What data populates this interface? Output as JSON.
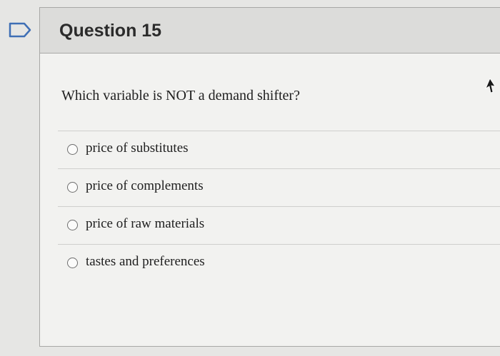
{
  "question": {
    "title": "Question 15",
    "prompt": "Which variable is NOT a demand shifter?",
    "answers": [
      {
        "label": "price of substitutes"
      },
      {
        "label": "price of complements"
      },
      {
        "label": "price of raw materials"
      },
      {
        "label": "tastes and preferences"
      }
    ]
  },
  "icons": {
    "flag": "flag-icon",
    "cursor": "mouse-cursor-icon"
  },
  "colors": {
    "flag_stroke": "#3f6fb5",
    "header_background": "#dcdcda",
    "card_background": "#f2f2f0"
  }
}
